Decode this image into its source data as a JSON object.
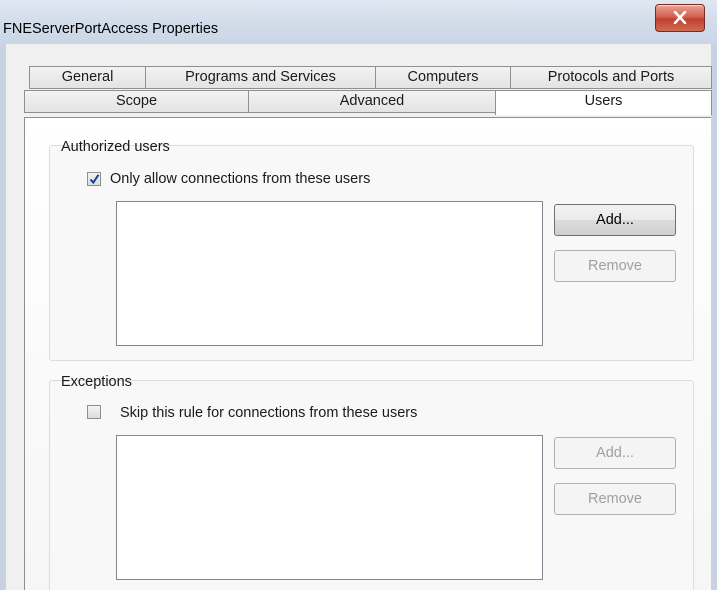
{
  "window": {
    "title": "FNEServerPortAccess Properties"
  },
  "tabs": {
    "row1": [
      "General",
      "Programs and Services",
      "Computers",
      "Protocols and Ports"
    ],
    "row2": [
      "Scope",
      "Advanced",
      "Users"
    ],
    "selected": "Users"
  },
  "authorized": {
    "group_label": "Authorized users",
    "checkbox_label": "Only allow connections from these users",
    "checked": true,
    "add_label": "Add...",
    "remove_label": "Remove"
  },
  "exceptions": {
    "group_label": "Exceptions",
    "checkbox_label": "Skip this rule for connections from these users",
    "checked": false,
    "add_label": "Add...",
    "remove_label": "Remove"
  },
  "colors": {
    "close_button": "#c0412d",
    "titlebar": "#d3deeb",
    "dialog_bg": "#f0f0f0"
  }
}
